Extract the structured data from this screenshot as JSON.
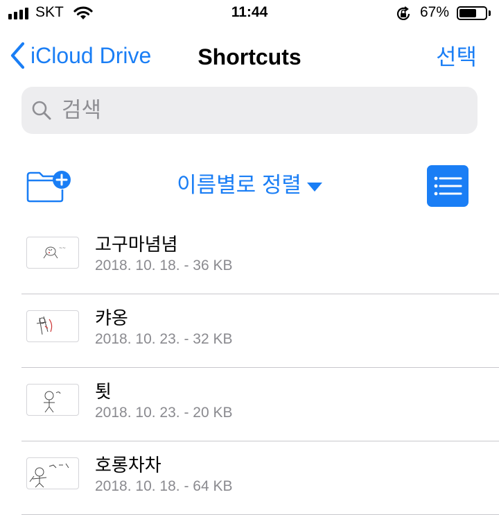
{
  "status_bar": {
    "carrier": "SKT",
    "time": "11:44",
    "battery_percent": "67%",
    "battery_level": 0.67,
    "icons": [
      "signal-bars-icon",
      "wifi-icon",
      "rotation-lock-icon",
      "battery-icon"
    ]
  },
  "nav": {
    "back_label": "iCloud Drive",
    "title": "Shortcuts",
    "select_label": "선택"
  },
  "search": {
    "placeholder": "검색",
    "value": ""
  },
  "toolbar": {
    "new_folder_icon": "folder-plus-icon",
    "sort_label": "이름별로 정렬",
    "view_toggle_icon": "list-view-icon"
  },
  "files": [
    {
      "name": "고구마념념",
      "meta": "2018. 10. 18. - 36 KB"
    },
    {
      "name": "캬옹",
      "meta": "2018. 10. 23. - 32 KB"
    },
    {
      "name": "툇",
      "meta": "2018. 10. 23. - 20 KB"
    },
    {
      "name": "호롱차차",
      "meta": "2018. 10. 18. - 64 KB"
    }
  ],
  "colors": {
    "accent": "#1a7ef5",
    "search_bg": "#ededef",
    "secondary_text": "#8a8a8f",
    "separator": "#c8c7cc"
  }
}
